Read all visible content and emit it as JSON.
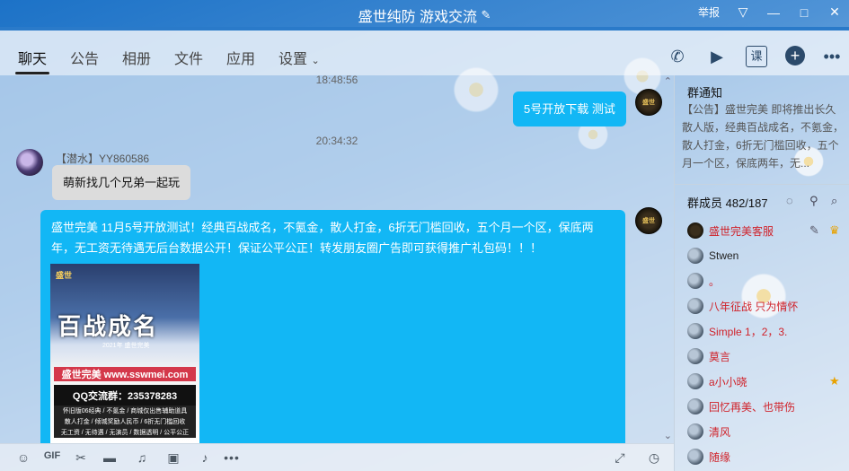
{
  "window": {
    "title": "盛世纯防 游戏交流",
    "report_label": "举报",
    "controls": {
      "dropdown": "▽",
      "minimize": "—",
      "maximize": "□",
      "close": "✕"
    }
  },
  "tabs": [
    "聊天",
    "公告",
    "相册",
    "文件",
    "应用",
    "设置"
  ],
  "tab_icons": [
    "phone-icon",
    "video-icon",
    "course-icon",
    "add-icon",
    "more-icon"
  ],
  "course_icon_label": "课",
  "chat": {
    "time1": "18:48:56",
    "msg_self_1": "5号开放下载 测试",
    "time2": "20:34:32",
    "msg2_sender": "【潜水】YY860586",
    "msg2_text": "萌新找几个兄弟一起玩",
    "msg3_text": "盛世完美  11月5号开放测试！经典百战成名，不氪金，散人打金，6折无门槛回收，五个月一个区，保底两年，无工资无待遇无后台数据公开！保证公平公正！转发朋友圈广告即可获得推广礼包码！！！",
    "avatar_text": "盛世",
    "poster": {
      "brand": "盛世",
      "headline": "百战成名",
      "year": "2021年 盛世完美",
      "site": "盛世完美 www.sswmei.com",
      "qq": "QQ交流群：235378283",
      "line1": "怀旧版06经典 / 不氪金 / 商城仅出售辅助道具",
      "line2": "散人打金 / 倾城奖励人民币 / 6折无门槛回收",
      "line3": "无工资 / 无待遇 / 无演员 / 数据透明 / 公平公正"
    }
  },
  "toolbar_icons": [
    "emoji-icon",
    "gif-icon",
    "scissors-icon",
    "folder-icon",
    "music-icon",
    "image-icon",
    "bell-icon",
    "more-icon",
    "expand-icon",
    "clock-icon"
  ],
  "gif_label": "GIF",
  "notice": {
    "title": "群通知",
    "body": "【公告】盛世完美 即将推出长久散人版，经典百战成名，不氪金，散人打金，6折无门槛回收，五个月一个区，保底两年，无..."
  },
  "members": {
    "title": "群成员 482/187",
    "list": [
      {
        "name": "盛世完美客服",
        "color": "#d0222a"
      },
      {
        "name": "Stwen",
        "color": "#222222"
      },
      {
        "name": "。",
        "color": "#d0222a"
      },
      {
        "name": "八年征战 只为情怀",
        "color": "#d0222a"
      },
      {
        "name": "Simple 1，2，3.",
        "color": "#d0222a"
      },
      {
        "name": "莫言",
        "color": "#d0222a"
      },
      {
        "name": "a小小晓",
        "color": "#d0222a"
      },
      {
        "name": "回忆再美、也带伤",
        "color": "#d0222a"
      },
      {
        "name": "清风",
        "color": "#d0222a"
      },
      {
        "name": "随缘",
        "color": "#d0222a"
      }
    ]
  }
}
